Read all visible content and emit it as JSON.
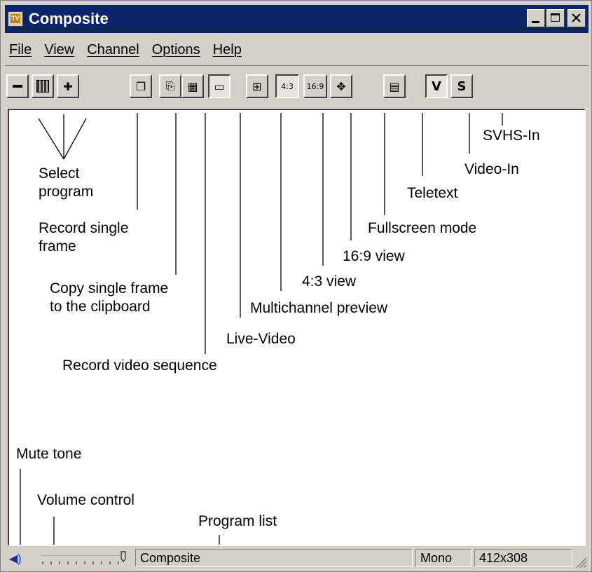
{
  "window": {
    "title": "Composite"
  },
  "menu": {
    "file": "File",
    "view": "View",
    "channel": "Channel",
    "options": "Options",
    "help": "Help"
  },
  "toolbar": {
    "view_43": "4:3",
    "view_169": "16:9",
    "video_in": "V",
    "svhs_in": "S"
  },
  "callouts": {
    "select_program": "Select\nprogram",
    "record_single_frame": "Record single\nframe",
    "copy_frame": "Copy single frame\nto the clipboard",
    "record_sequence": "Record video sequence",
    "live_video": "Live-Video",
    "multichannel": "Multichannel preview",
    "view_43": "4:3 view",
    "view_169": "16:9 view",
    "fullscreen": "Fullscreen mode",
    "teletext": "Teletext",
    "video_in": "Video-In",
    "svhs_in": "SVHS-In",
    "mute": "Mute tone",
    "volume": "Volume control",
    "program_list": "Program list"
  },
  "status": {
    "program": "Composite",
    "audio": "Mono",
    "resolution": "412x308"
  },
  "colors": {
    "titlebar": "#0a246a",
    "face": "#d4d0c8",
    "canvas": "#ffffff"
  }
}
